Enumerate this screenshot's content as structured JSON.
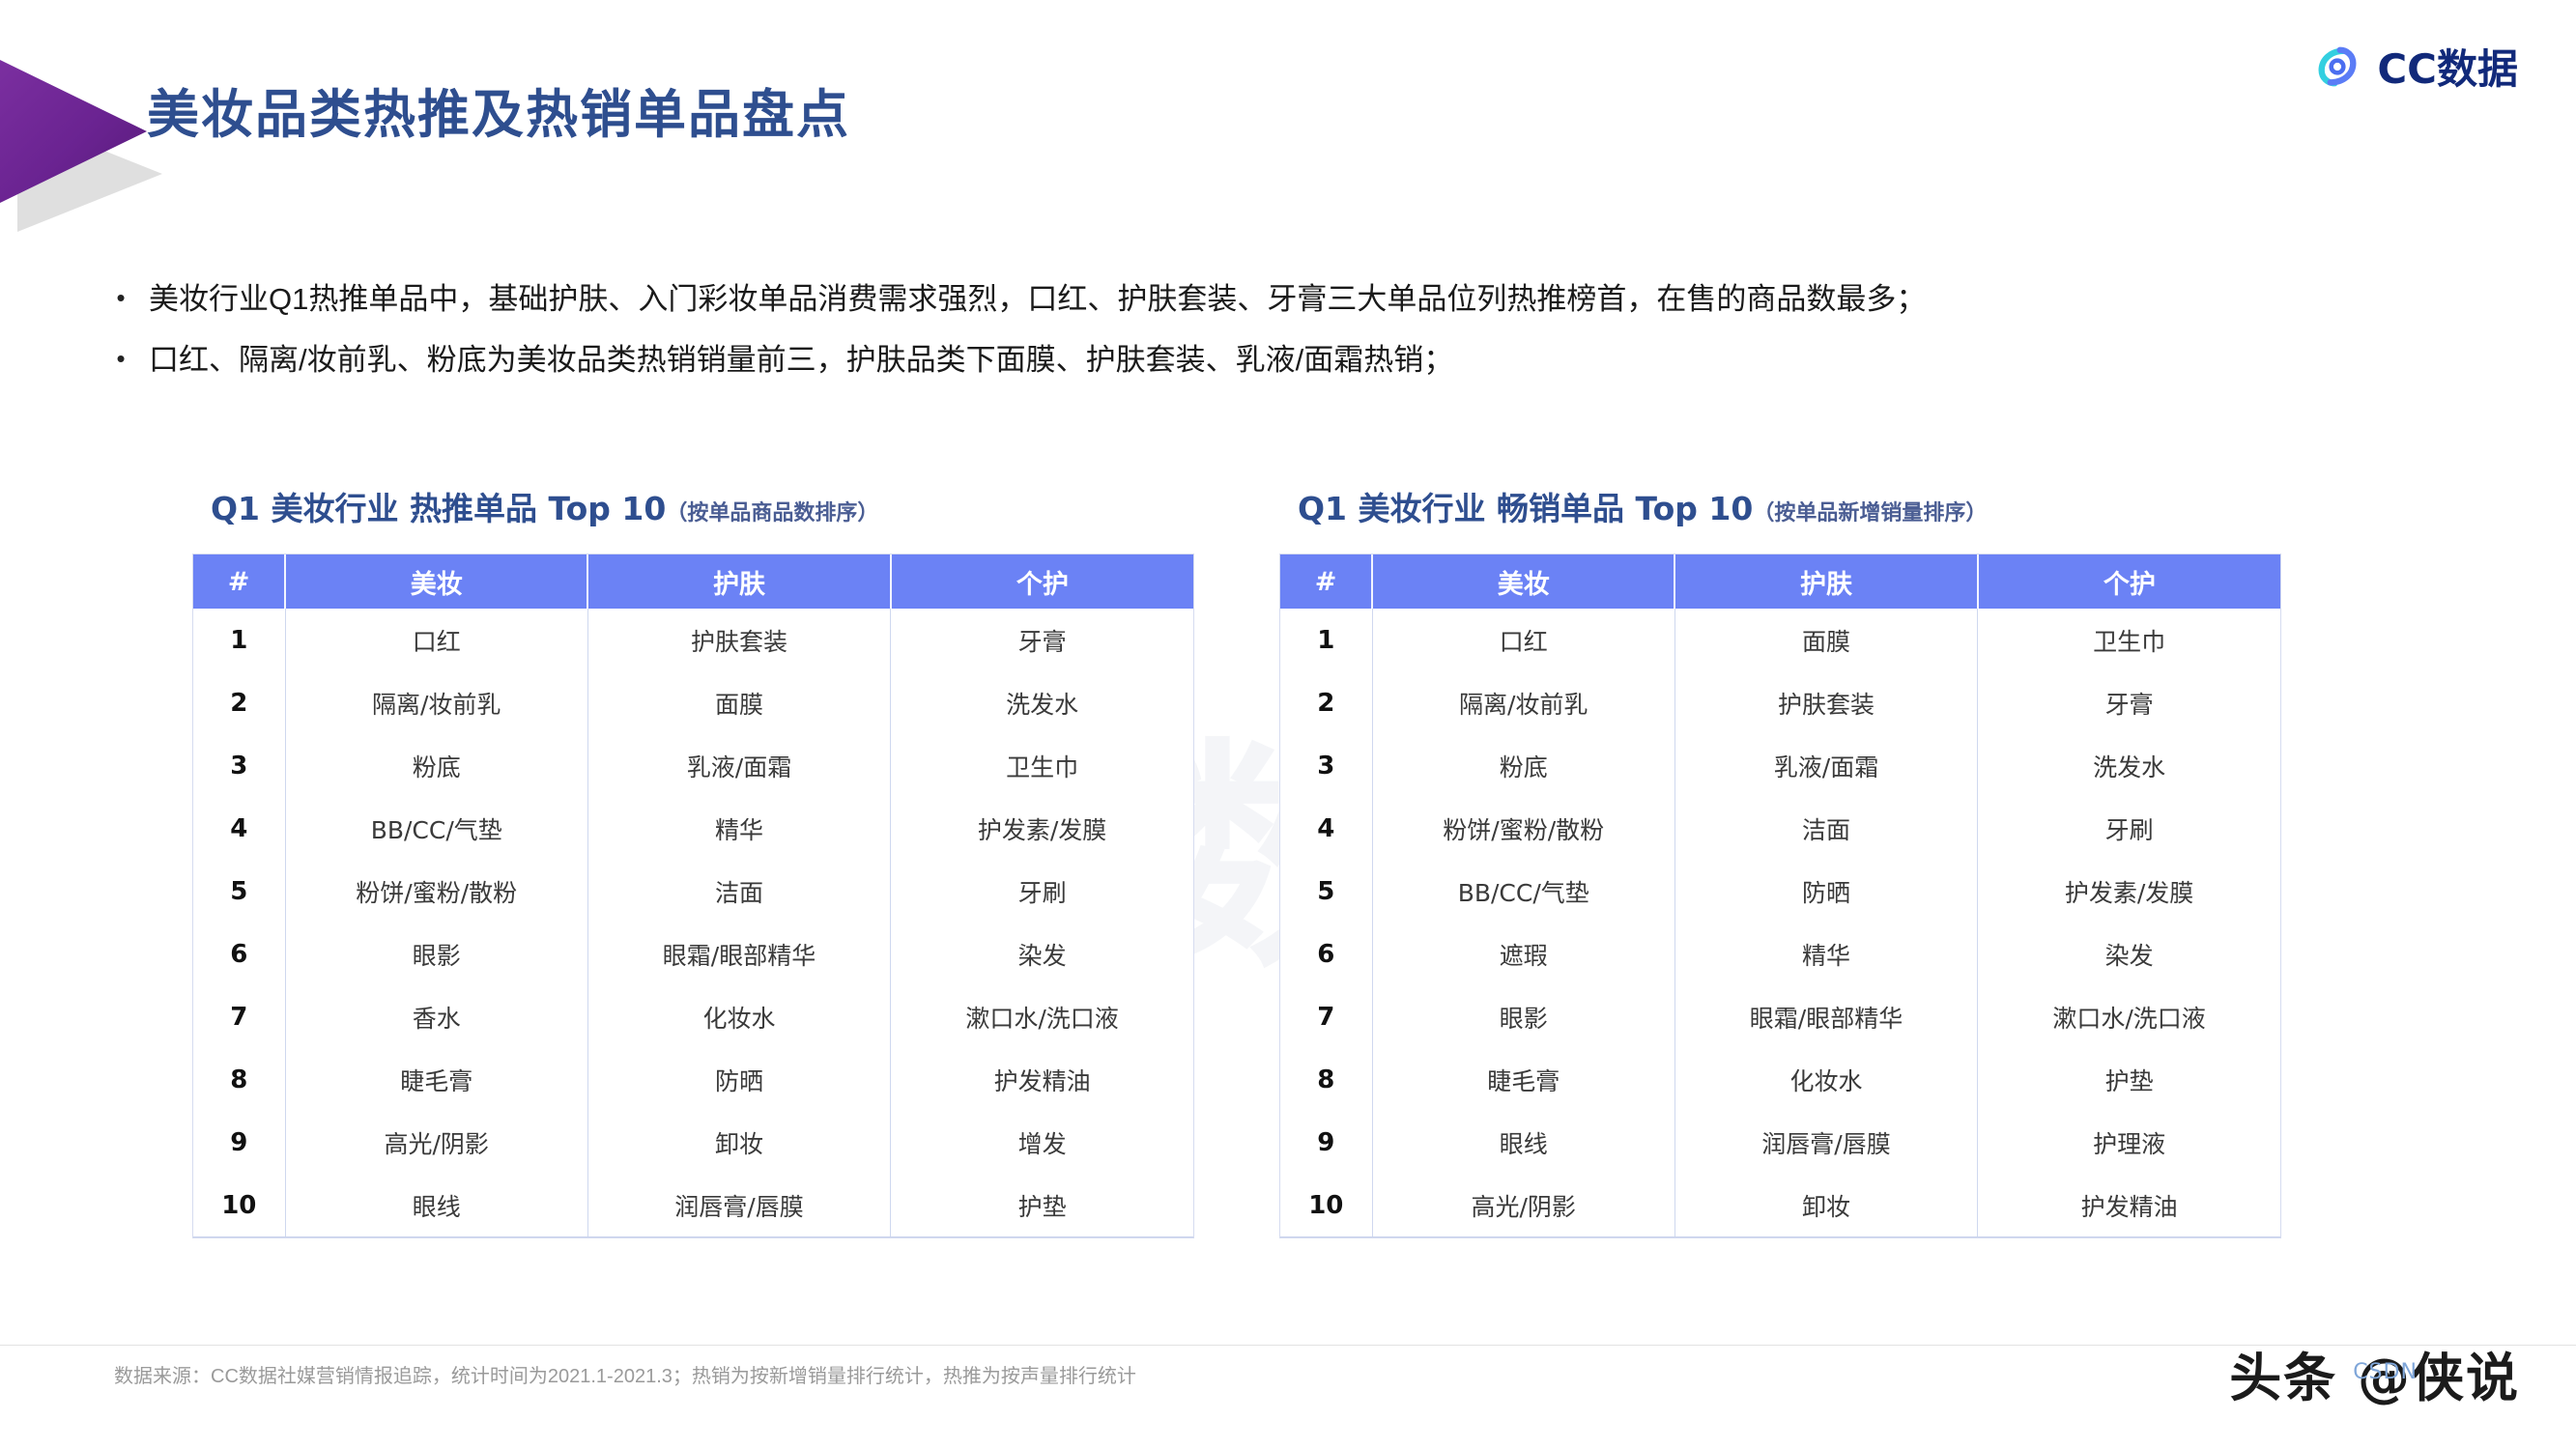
{
  "brand": {
    "name": "CC数据",
    "logo_icon": "cc-swirl-logo-icon",
    "color_primary": "#11297a",
    "color_accent_cyan": "#38d6e0",
    "color_accent_blue": "#5b7cf6"
  },
  "header": {
    "title": "美妆品类热推及热销单品盘点",
    "title_color": "#2e4e8f",
    "arrow_color": "#6a2391"
  },
  "bullets": [
    {
      "marker": "•",
      "text": "美妆行业Q1热推单品中，基础护肤、入门彩妆单品消费需求强烈，口红、护肤套装、牙膏三大单品位列热推榜首，在售的商品数最多；"
    },
    {
      "marker": "•",
      "text": "口红、隔离/妆前乳、粉底为美妆品类热销销量前三，护肤品类下面膜、护肤套装、乳液/面霜热销；"
    }
  ],
  "watermark": {
    "mark_icon": "cc-swirl-logo-icon",
    "text": "CC数据"
  },
  "tables": {
    "header_bg": "#6b82f5",
    "left": {
      "title_main": "Q1 美妆行业 热推单品 Top 10",
      "title_sub": "（按单品商品数排序）",
      "columns": [
        "#",
        "美妆",
        "护肤",
        "个护"
      ],
      "rows": [
        [
          "1",
          "口红",
          "护肤套装",
          "牙膏"
        ],
        [
          "2",
          "隔离/妆前乳",
          "面膜",
          "洗发水"
        ],
        [
          "3",
          "粉底",
          "乳液/面霜",
          "卫生巾"
        ],
        [
          "4",
          "BB/CC/气垫",
          "精华",
          "护发素/发膜"
        ],
        [
          "5",
          "粉饼/蜜粉/散粉",
          "洁面",
          "牙刷"
        ],
        [
          "6",
          "眼影",
          "眼霜/眼部精华",
          "染发"
        ],
        [
          "7",
          "香水",
          "化妆水",
          "漱口水/洗口液"
        ],
        [
          "8",
          "睫毛膏",
          "防晒",
          "护发精油"
        ],
        [
          "9",
          "高光/阴影",
          "卸妆",
          "增发"
        ],
        [
          "10",
          "眼线",
          "润唇膏/唇膜",
          "护垫"
        ]
      ]
    },
    "right": {
      "title_main": "Q1 美妆行业 畅销单品 Top 10",
      "title_sub": "（按单品新增销量排序）",
      "columns": [
        "#",
        "美妆",
        "护肤",
        "个护"
      ],
      "rows": [
        [
          "1",
          "口红",
          "面膜",
          "卫生巾"
        ],
        [
          "2",
          "隔离/妆前乳",
          "护肤套装",
          "牙膏"
        ],
        [
          "3",
          "粉底",
          "乳液/面霜",
          "洗发水"
        ],
        [
          "4",
          "粉饼/蜜粉/散粉",
          "洁面",
          "牙刷"
        ],
        [
          "5",
          "BB/CC/气垫",
          "防晒",
          "护发素/发膜"
        ],
        [
          "6",
          "遮瑕",
          "精华",
          "染发"
        ],
        [
          "7",
          "眼影",
          "眼霜/眼部精华",
          "漱口水/洗口液"
        ],
        [
          "8",
          "睫毛膏",
          "化妆水",
          "护垫"
        ],
        [
          "9",
          "眼线",
          "润唇膏/唇膜",
          "护理液"
        ],
        [
          "10",
          "高光/阴影",
          "卸妆",
          "护发精油"
        ]
      ]
    }
  },
  "footer": {
    "source_note": "数据来源：CC数据社媒营销情报追踪，统计时间为2021.1-2021.3；热销为按新增销量排行统计，热推为按声量排行统计",
    "toutiao_watermark": "头条 @侠说",
    "csdn_watermark": "CSDN"
  }
}
